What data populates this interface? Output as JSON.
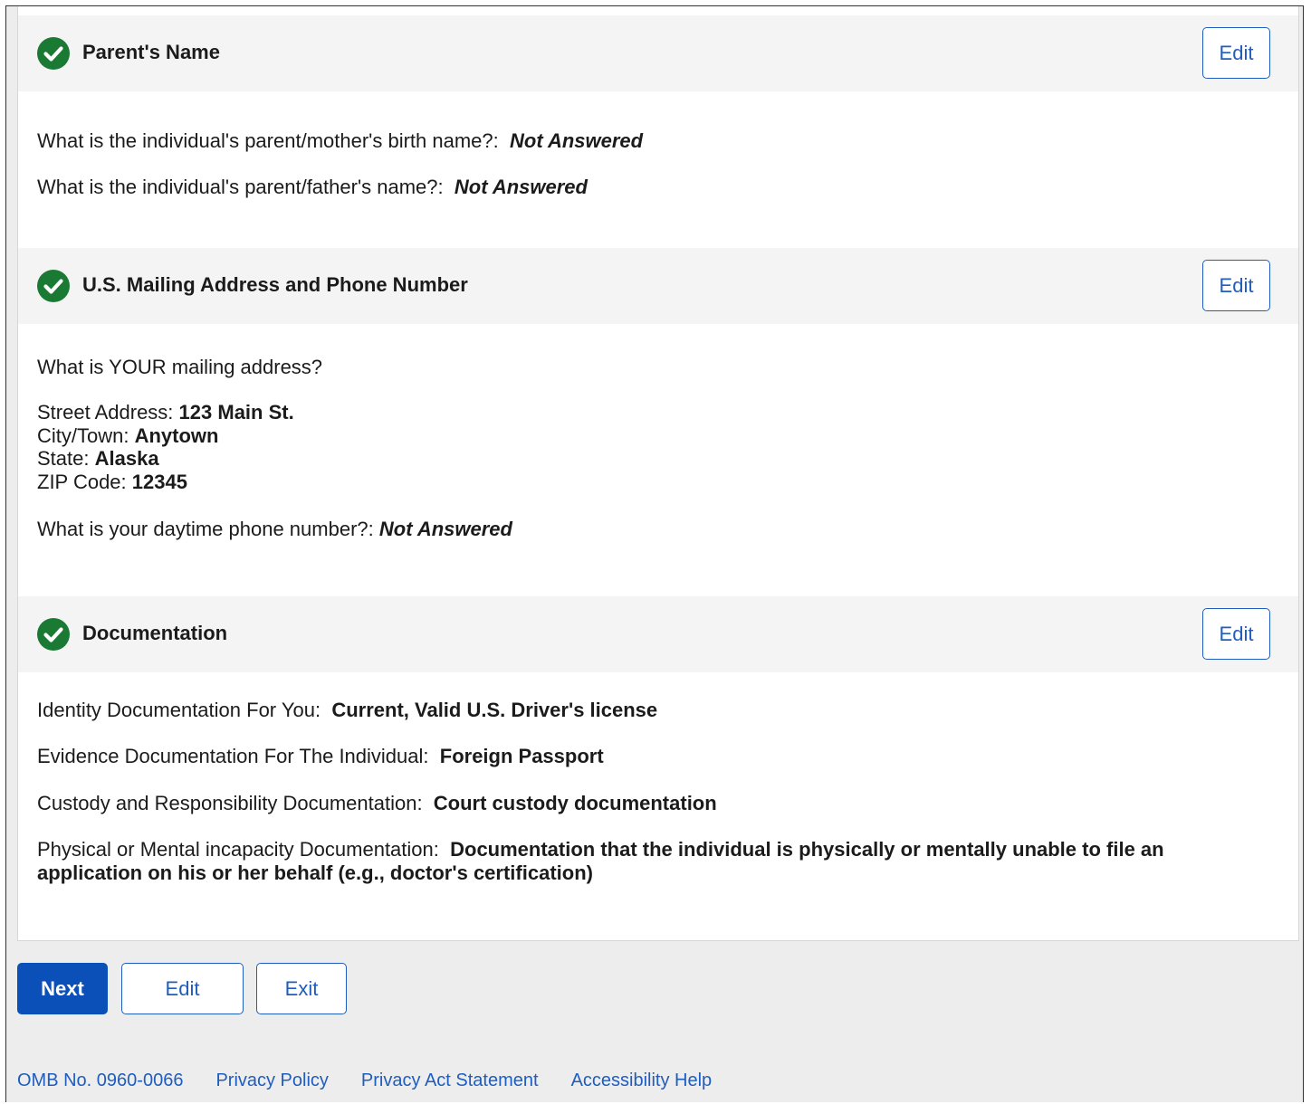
{
  "sections": [
    {
      "title": "Parent's Name",
      "edit_label": "Edit",
      "status_icon": "check-circle-icon",
      "rows": [
        {
          "label": "What is the individual's parent/mother's birth name?:",
          "value": "Not Answered"
        },
        {
          "label": "What is the individual's parent/father's name?:",
          "value": "Not Answered"
        }
      ]
    },
    {
      "title": "U.S. Mailing Address and Phone Number",
      "edit_label": "Edit",
      "status_icon": "check-circle-icon",
      "mailing_question": "What is YOUR mailing address?",
      "address": [
        {
          "label": "Street Address:",
          "value": "123 Main St."
        },
        {
          "label": "City/Town:",
          "value": "Anytown"
        },
        {
          "label": "State:",
          "value": "Alaska"
        },
        {
          "label": "ZIP Code:",
          "value": "12345"
        }
      ],
      "phone": {
        "label": "What is your daytime phone number?:",
        "value": "Not Answered"
      }
    },
    {
      "title": "Documentation",
      "edit_label": "Edit",
      "status_icon": "check-circle-icon",
      "rows": [
        {
          "label": "Identity Documentation For You:",
          "value": "Current, Valid U.S. Driver's license"
        },
        {
          "label": "Evidence Documentation For The Individual:",
          "value": "Foreign Passport"
        },
        {
          "label": "Custody and Responsibility Documentation:",
          "value": "Court custody documentation"
        },
        {
          "label": "Physical or Mental incapacity Documentation:",
          "value": "Documentation that the individual is physically or mentally unable to file an application on his or her behalf (e.g., doctor's certification)"
        }
      ]
    }
  ],
  "actions": {
    "next": "Next",
    "edit": "Edit",
    "exit": "Exit"
  },
  "footer": {
    "omb": "OMB No. 0960-0066",
    "links": [
      "Privacy Policy",
      "Privacy Act Statement",
      "Accessibility Help"
    ]
  },
  "colors": {
    "check_green": "#1a7a34",
    "link_blue": "#1f5dbf",
    "primary_blue": "#0b4fb8"
  }
}
